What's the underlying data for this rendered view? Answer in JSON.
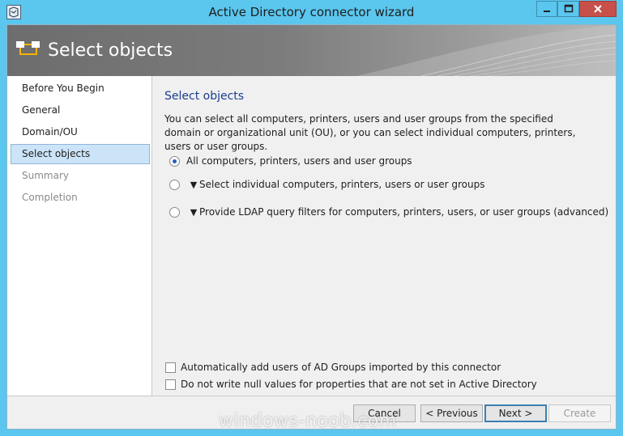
{
  "window": {
    "title": "Active Directory connector wizard"
  },
  "header": {
    "title": "Select objects"
  },
  "nav": {
    "items": [
      {
        "label": "Before You Begin",
        "state": "normal"
      },
      {
        "label": "General",
        "state": "normal"
      },
      {
        "label": "Domain/OU",
        "state": "normal"
      },
      {
        "label": "Select objects",
        "state": "active"
      },
      {
        "label": "Summary",
        "state": "disabled"
      },
      {
        "label": "Completion",
        "state": "disabled"
      }
    ]
  },
  "content": {
    "title": "Select objects",
    "description": "You can select all computers, printers, users and user groups from the specified domain or organizational unit (OU), or you can select individual computers, printers, users or user groups.",
    "options": [
      {
        "label": "All computers, printers, users and user groups",
        "checked": true,
        "expandable": false
      },
      {
        "label": "Select individual computers, printers, users or user groups",
        "checked": false,
        "expandable": true
      },
      {
        "label": "Provide LDAP query filters for computers, printers, users, or user groups (advanced)",
        "checked": false,
        "expandable": true
      }
    ],
    "checkboxes": [
      {
        "label": "Automatically add users of AD Groups imported by this connector",
        "checked": false
      },
      {
        "label": "Do not write null values for properties that are not set in Active Directory",
        "checked": false
      }
    ]
  },
  "footer": {
    "cancel_label": "Cancel",
    "previous_label": "< Previous",
    "next_label": "Next >",
    "create_label": "Create"
  },
  "watermark": "windows-noob.com",
  "colors": {
    "chrome": "#5bc6ee",
    "close_button": "#c7504b",
    "content_title": "#1a3d8f",
    "nav_selected": "#cce4f7"
  }
}
